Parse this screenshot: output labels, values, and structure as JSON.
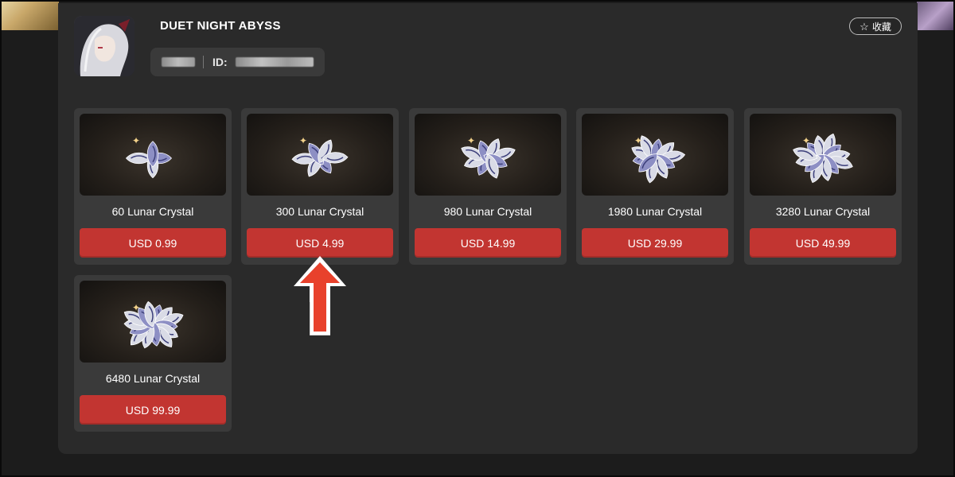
{
  "game": {
    "title": "DUET NIGHT ABYSS",
    "account": {
      "id_label": "ID:"
    },
    "favorite_label": "收藏"
  },
  "products": [
    {
      "name": "60 Lunar Crystal",
      "price": "USD 0.99",
      "tier": 1
    },
    {
      "name": "300 Lunar Crystal",
      "price": "USD 4.99",
      "tier": 2
    },
    {
      "name": "980 Lunar Crystal",
      "price": "USD 14.99",
      "tier": 3
    },
    {
      "name": "1980 Lunar Crystal",
      "price": "USD 29.99",
      "tier": 4
    },
    {
      "name": "3280 Lunar Crystal",
      "price": "USD 49.99",
      "tier": 5
    },
    {
      "name": "6480 Lunar Crystal",
      "price": "USD 99.99",
      "tier": 6
    }
  ],
  "colors": {
    "accent": "#c23531",
    "card_bg": "#3a3a3a",
    "panel_bg": "#2a2a2a",
    "highlight_arrow": "#e8412c"
  }
}
